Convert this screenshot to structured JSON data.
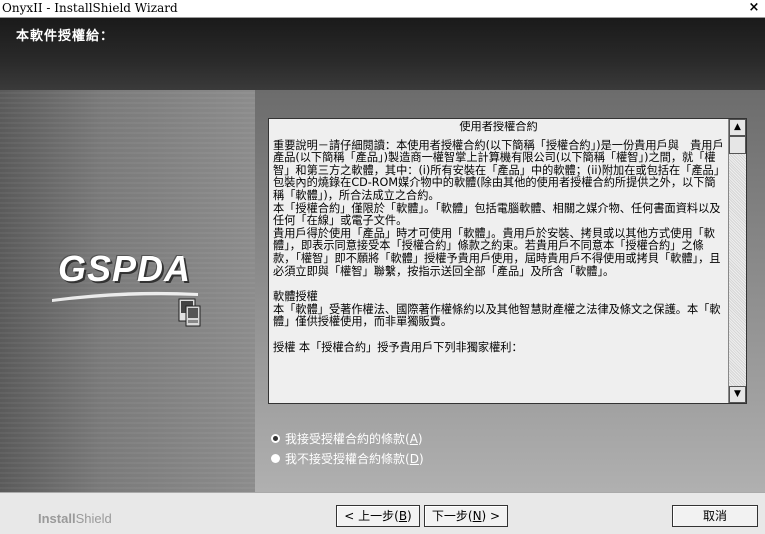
{
  "window": {
    "title": "OnyxII - InstallShield Wizard",
    "close_glyph": "×"
  },
  "header": {
    "title": "本軟件授權給："
  },
  "left_panel": {
    "logo_text": "GSPDA",
    "icon": "pda-device-icon"
  },
  "license": {
    "heading": "使用者授權合約",
    "paragraphs": [
      "重要說明－請仔細閱讀：本使用者授權合約(以下簡稱「授權合約」)是一份貴用戶與　貴用戶產品(以下簡稱「產品」)製造商一權智掌上計算機有限公司(以下簡稱「權智」)之間，就「權智」和第三方之軟體，其中：(i)所有安裝在「產品」中的軟體；(ii)附加在或包括在「產品」包裝內的燒錄在CD-ROM媒介物中的軟體(除由其他的使用者授權合約所提供之外，以下簡稱「軟體」)，所合法成立之合約。",
      "本「授權合約」僅限於「軟體」。「軟體」包括電腦軟體、相關之媒介物、任何書面資料以及任何「在線」或電子文件。",
      "貴用戶得於使用「產品」時才可使用「軟體」。貴用戶於安裝、拷貝或以其他方式使用「軟體」，即表示同意接受本「授權合約」條款之約束。若貴用戶不同意本「授權合約」之條款，「權智」即不願將「軟體」授權予貴用戶使用，屆時貴用戶不得使用或拷貝「軟體」，且必須立即與「權智」聯繫，按指示送回全部「產品」及所含「軟體」。",
      "",
      "軟體授權",
      "本「軟體」受著作權法、國際著作權條約以及其他智慧財產權之法律及條文之保護。本「軟體」僅供授權使用，而非單獨販賣。",
      "",
      "授權 本「授權合約」授予貴用戶下列非獨家權利："
    ],
    "scroll_up": "▲",
    "scroll_down": "▼"
  },
  "options": {
    "accept_label": "我接受授權合約的條款(",
    "accept_key": "A",
    "decline_label": "我不接受授權合約條款(",
    "decline_key": "D",
    "close_paren": ")",
    "selected": "accept"
  },
  "footer": {
    "brand_bold": "Install",
    "brand_light": "Shield",
    "back_label": "< 上一步(",
    "back_key": "B",
    "next_label": "下一步(",
    "next_key": "N",
    "next_suffix": ") >",
    "back_suffix": ")",
    "cancel_label": "取消"
  },
  "colors": {
    "header_bg": "#1f1f1f",
    "license_bg": "#efefef",
    "footer_bg": "#e8e8e8"
  }
}
